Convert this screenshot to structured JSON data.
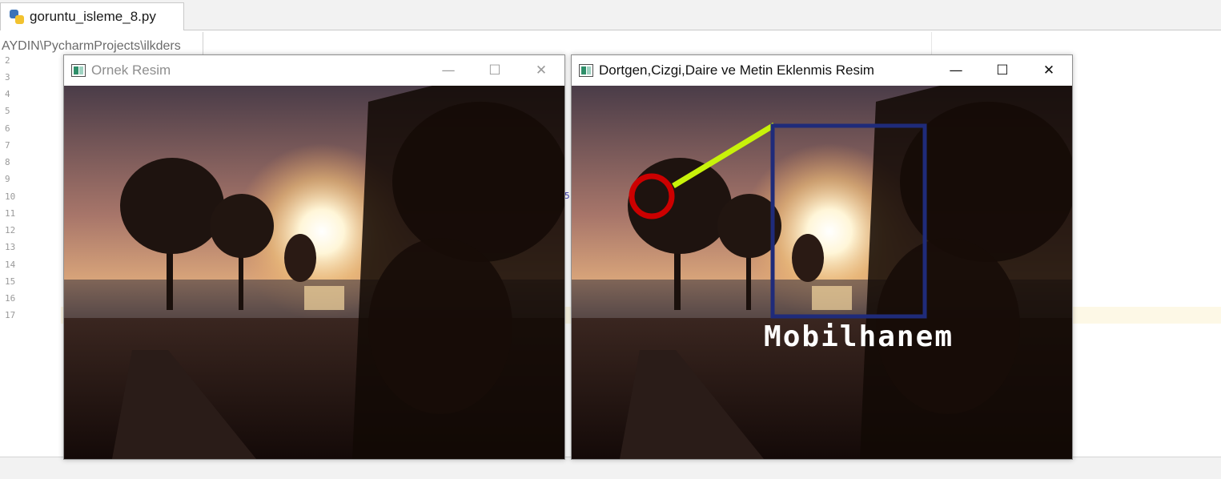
{
  "editor": {
    "tab": {
      "filename": "goruntu_isleme_8.py",
      "icon": "python-file-icon"
    },
    "breadcrumb": "AYDIN\\PycharmProjects\\ilkders",
    "line_numbers": [
      "2",
      "3",
      "4",
      "5",
      "6",
      "7",
      "8",
      "9",
      "10",
      "11",
      "12",
      "13",
      "14",
      "15",
      "16",
      "17"
    ],
    "stray_char": "5"
  },
  "windows": [
    {
      "title": "Ornek Resim",
      "state": "inactive",
      "icon": "opencv-window-icon",
      "controls": {
        "minimize": "—",
        "maximize": "☐",
        "close": "✕"
      }
    },
    {
      "title": "Dortgen,Cizgi,Daire ve Metin Eklenmis Resim",
      "state": "active",
      "icon": "opencv-window-icon",
      "controls": {
        "minimize": "—",
        "maximize": "☐",
        "close": "✕"
      },
      "overlays": {
        "text": "Mobilhanem",
        "text_color": "#ffffff",
        "rectangle_color": "#1f2b7a",
        "line_color": "#c8f20a",
        "circle_color": "#cc0000"
      }
    }
  ],
  "colors": {
    "current_line": "#fdf8e6",
    "inactive_title": "#8e8e8e"
  }
}
